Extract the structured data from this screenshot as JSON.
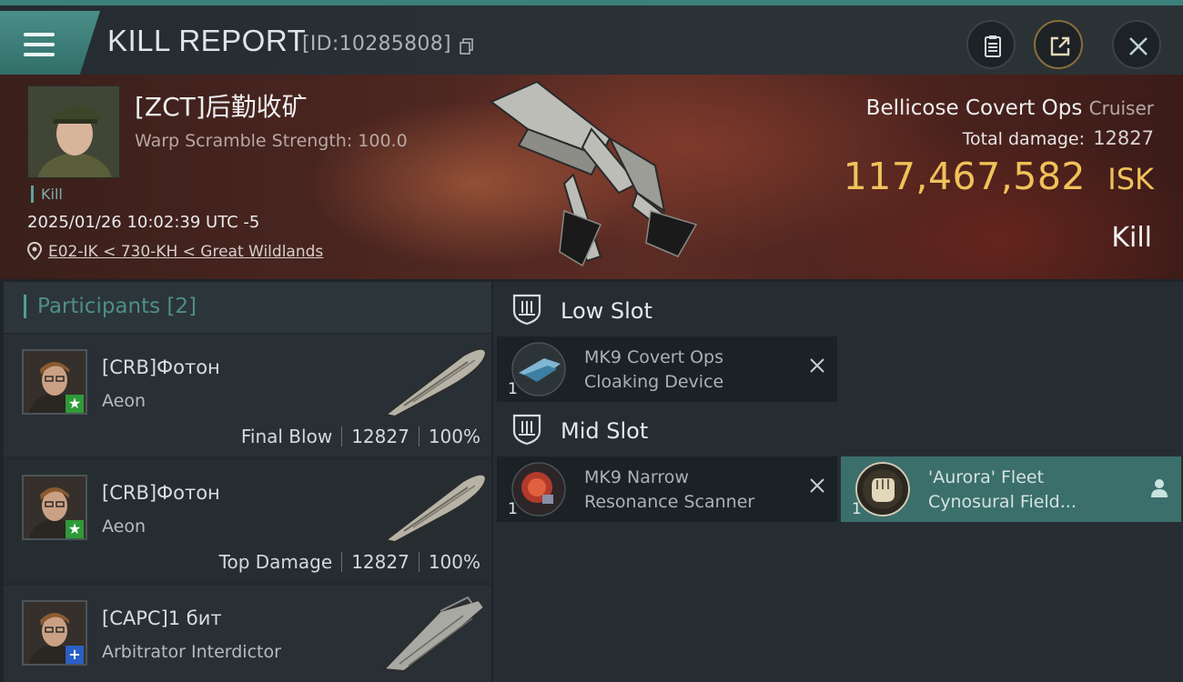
{
  "header": {
    "title": "KILL REPORT",
    "id_text": "[ID:10285808]"
  },
  "victim": {
    "name": "[ZCT]后勤收矿",
    "warp": "Warp Scramble Strength: 100.0",
    "tag": "Kill",
    "time": "2025/01/26 10:02:39 UTC -5",
    "location": "E02-IK < 730-KH < Great Wildlands"
  },
  "ship": {
    "name": "Bellicose Covert Ops",
    "class": "Cruiser",
    "damage_label": "Total damage:",
    "damage_value": "12827",
    "isk_value": "117,467,582",
    "isk_unit": "ISK",
    "kill_type": "Kill"
  },
  "participants": {
    "title": "Participants [2]",
    "rows": [
      {
        "name": "[CRB]Фотон",
        "ship": "Aeon",
        "role": "Final Blow",
        "damage": "12827",
        "percent": "100%",
        "badge": "★"
      },
      {
        "name": "[CRB]Фотон",
        "ship": "Aeon",
        "role": "Top Damage",
        "damage": "12827",
        "percent": "100%",
        "badge": "★"
      },
      {
        "name": "[CAPC]1 бит",
        "ship": "Arbitrator Interdictor",
        "badge": "+"
      }
    ]
  },
  "slots": {
    "low": {
      "title": "Low Slot",
      "modules": [
        {
          "qty": "1",
          "name1": "MK9 Covert Ops",
          "name2": "Cloaking Device"
        }
      ]
    },
    "mid": {
      "title": "Mid Slot",
      "modules": [
        {
          "qty": "1",
          "name1": "MK9 Narrow",
          "name2": "Resonance Scanner"
        },
        {
          "qty": "1",
          "name1": "'Aurora' Fleet",
          "name2": "Cynosural Field..."
        }
      ]
    }
  },
  "colors": {
    "accent": "#3d7f7a",
    "isk": "#f0c25a",
    "badge_green": "#2e9a3a",
    "badge_blue": "#2a5fc4"
  }
}
